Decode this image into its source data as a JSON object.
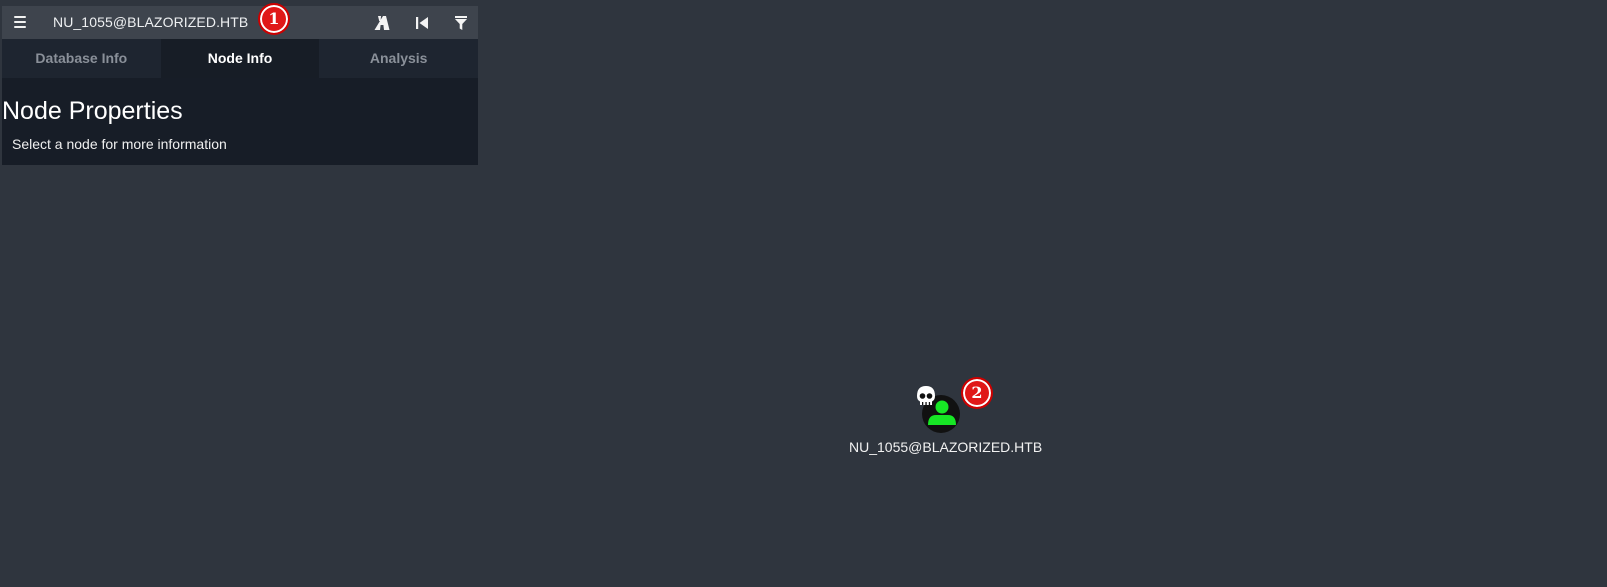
{
  "search": {
    "value": "NU_1055@BLAZORIZED.HTB",
    "menu_icon": "hamburger-menu-icon",
    "tools": [
      {
        "name": "pathfinding-road-icon"
      },
      {
        "name": "back-icon"
      },
      {
        "name": "filter-icon"
      }
    ]
  },
  "badges": {
    "first": "1",
    "second": "2"
  },
  "tabs": [
    {
      "label": "Database Info",
      "active": false
    },
    {
      "label": "Node Info",
      "active": true
    },
    {
      "label": "Analysis",
      "active": false
    }
  ],
  "panel": {
    "title": "Node Properties",
    "hint": "Select a node for more information"
  },
  "graph": {
    "node": {
      "label": "NU_1055@BLAZORIZED.HTB",
      "type_icon": "user-icon",
      "marker_icon": "skull-icon",
      "color": "#17e625"
    }
  },
  "colors": {
    "background": "#2f353e",
    "badge": "#e01818"
  }
}
